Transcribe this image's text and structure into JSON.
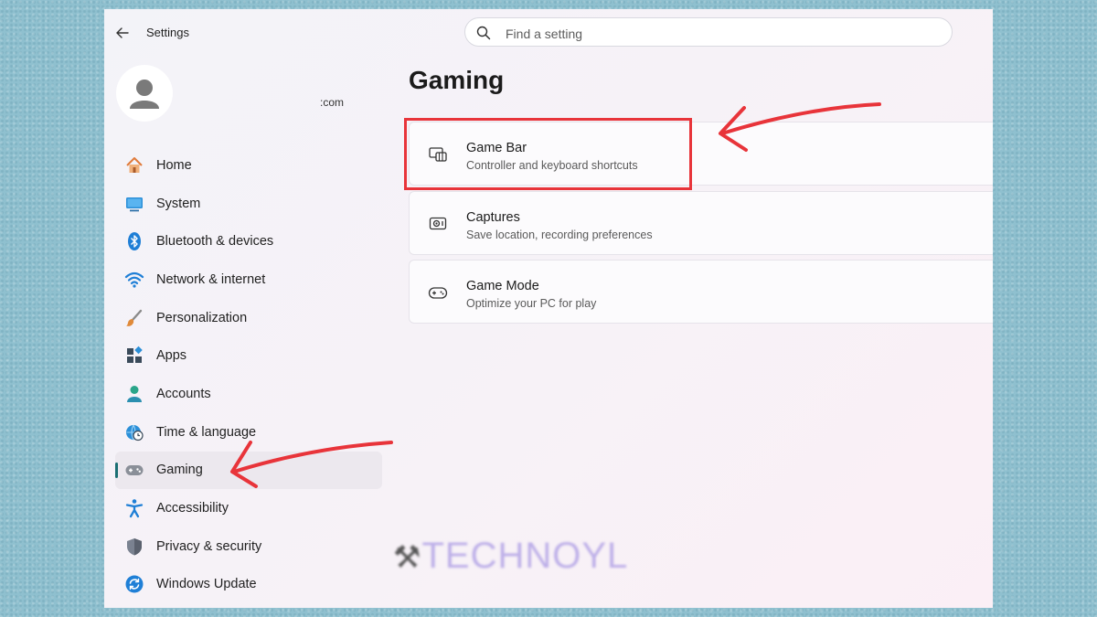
{
  "titlebar": {
    "title": "Settings"
  },
  "search": {
    "placeholder": "Find a setting"
  },
  "account": {
    "email_fragment": "com"
  },
  "sidebar": {
    "items": [
      {
        "label": "Home",
        "icon": "home-icon"
      },
      {
        "label": "System",
        "icon": "monitor-icon"
      },
      {
        "label": "Bluetooth & devices",
        "icon": "bluetooth-icon"
      },
      {
        "label": "Network & internet",
        "icon": "wifi-icon"
      },
      {
        "label": "Personalization",
        "icon": "brush-icon"
      },
      {
        "label": "Apps",
        "icon": "apps-icon"
      },
      {
        "label": "Accounts",
        "icon": "person-icon"
      },
      {
        "label": "Time & language",
        "icon": "globe-clock-icon"
      },
      {
        "label": "Gaming",
        "icon": "gamepad-icon",
        "active": true
      },
      {
        "label": "Accessibility",
        "icon": "accessibility-icon"
      },
      {
        "label": "Privacy & security",
        "icon": "shield-icon"
      },
      {
        "label": "Windows Update",
        "icon": "update-icon"
      }
    ]
  },
  "main": {
    "title": "Gaming",
    "cards": [
      {
        "title": "Game Bar",
        "subtitle": "Controller and keyboard shortcuts",
        "icon": "game-bar-icon"
      },
      {
        "title": "Captures",
        "subtitle": "Save location, recording preferences",
        "icon": "capture-icon"
      },
      {
        "title": "Game Mode",
        "subtitle": "Optimize your PC for play",
        "icon": "controller-icon"
      }
    ]
  },
  "watermark": {
    "text": "TECHNOYL"
  },
  "colors": {
    "accent": "#1a6f73",
    "annotation_red": "#e8343a",
    "background": "#8fc0cf"
  }
}
